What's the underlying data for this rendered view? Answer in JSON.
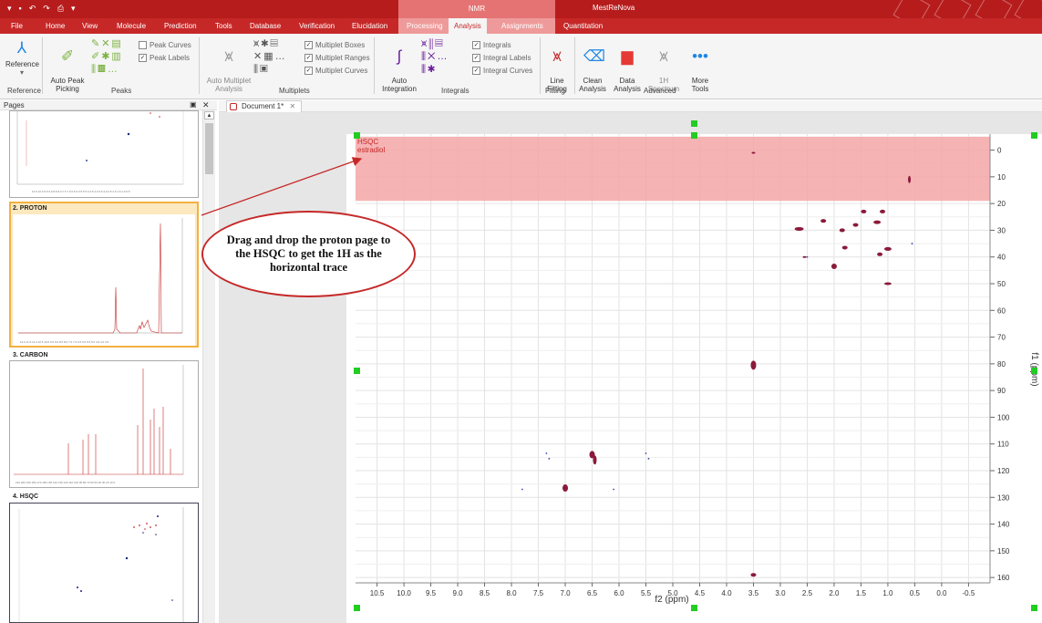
{
  "titlebar": {
    "context_group": "NMR",
    "app_title": "MestReNova"
  },
  "menu": [
    "File",
    "Home",
    "View",
    "Molecule",
    "Prediction",
    "Tools",
    "Database",
    "Verification",
    "Elucidation",
    "Processing",
    "Analysis",
    "Assignments",
    "Quantitation"
  ],
  "ribbon": {
    "reference_label": "Reference",
    "auto_peak_label": "Auto Peak\nPicking",
    "peak_curves": "Peak Curves",
    "peak_labels": "Peak Labels",
    "auto_multiplet_label": "Auto Multiplet\nAnalysis",
    "multiplet_boxes": "Multiplet Boxes",
    "multiplet_ranges": "Multiplet Ranges",
    "multiplet_curves": "Multiplet Curves",
    "auto_integration_label": "Auto\nIntegration",
    "integrals_chk": "Integrals",
    "integral_labels": "Integral Labels",
    "integral_curves": "Integral Curves",
    "line_fitting": "Line\nFitting",
    "clean_analysis": "Clean\nAnalysis",
    "data_analysis": "Data\nAnalysis",
    "spectrum_1h": "1H\nSpectrum",
    "more_tools": "More\nTools",
    "groups": {
      "reference": "Reference",
      "peaks": "Peaks",
      "multiplets": "Multiplets",
      "integrals": "Integrals",
      "fitting": "Fitting",
      "advanced": "Advanced"
    }
  },
  "pages_panel": {
    "title": "Pages",
    "pages": [
      {
        "label": "2. PROTON"
      },
      {
        "label": "3. CARBON"
      },
      {
        "label": "4. HSQC"
      }
    ]
  },
  "document": {
    "tab_label": "Document 1*"
  },
  "spectrum": {
    "label_line1": "HSQC",
    "label_line2": "estradiol",
    "x_axis_title": "f2 (ppm)",
    "y_axis_title": "f1 (ppm)",
    "x_ticks": [
      "10.5",
      "10.0",
      "9.5",
      "9.0",
      "8.5",
      "8.0",
      "7.5",
      "7.0",
      "6.5",
      "6.0",
      "5.5",
      "5.0",
      "4.5",
      "4.0",
      "3.5",
      "3.0",
      "2.5",
      "2.0",
      "1.5",
      "1.0",
      "0.5",
      "0.0",
      "-0.5"
    ],
    "y_ticks": [
      "0",
      "10",
      "20",
      "30",
      "40",
      "50",
      "60",
      "70",
      "80",
      "90",
      "100",
      "110",
      "120",
      "130",
      "140",
      "150",
      "160"
    ],
    "highlight_color": "#f4a6a6",
    "peak_color": "#8b1a3a"
  },
  "callout": {
    "text": "Drag and drop the proton page to\nthe HSQC to get the 1H as the\nhorizontal trace"
  }
}
